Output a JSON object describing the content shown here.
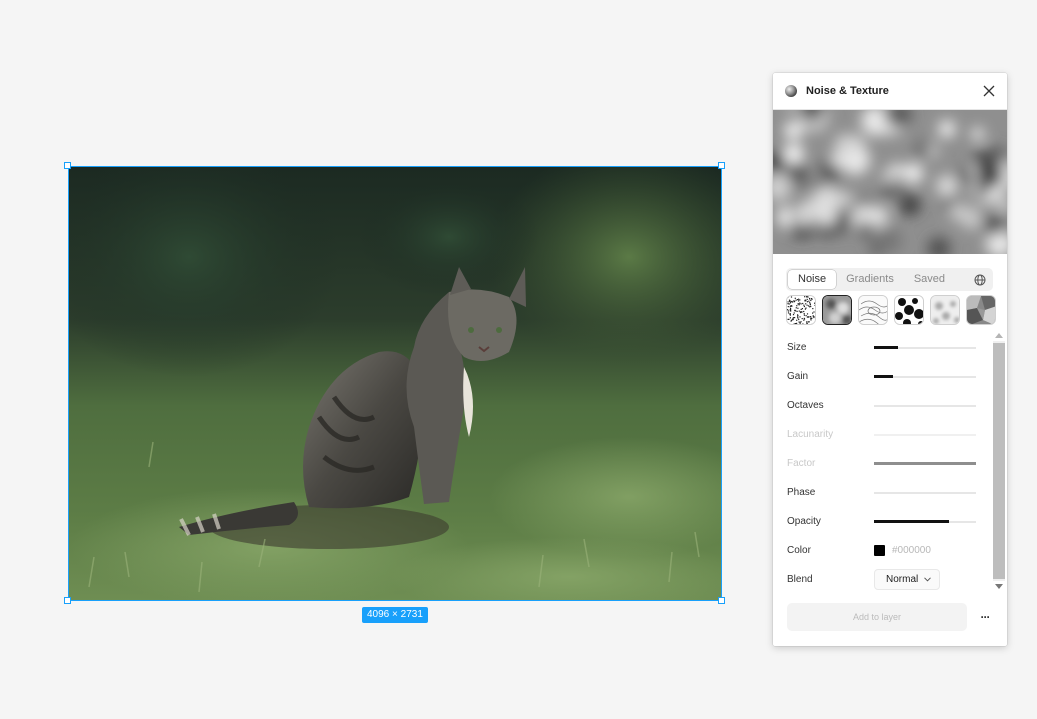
{
  "canvas": {
    "image_dimensions": "4096 × 2731",
    "selection_color": "#18a0fb"
  },
  "panel": {
    "title": "Noise & Texture",
    "icon": "plugin-globe-icon",
    "tabs": [
      {
        "label": "Noise",
        "active": true
      },
      {
        "label": "Gradients",
        "active": false
      },
      {
        "label": "Saved",
        "active": false
      }
    ],
    "globe_icon": "globe-icon",
    "presets": [
      {
        "name": "static",
        "selected": false
      },
      {
        "name": "blur",
        "selected": true
      },
      {
        "name": "contour",
        "selected": false
      },
      {
        "name": "blobs",
        "selected": false
      },
      {
        "name": "marble",
        "selected": false
      },
      {
        "name": "cells",
        "selected": false
      }
    ],
    "controls": {
      "size": {
        "label": "Size",
        "value": 0.24
      },
      "gain": {
        "label": "Gain",
        "value": 0.19
      },
      "octaves": {
        "label": "Octaves",
        "value": 0
      },
      "lacunarity": {
        "label": "Lacunarity",
        "value": 0,
        "disabled": true
      },
      "factor": {
        "label": "Factor",
        "value": 1.0,
        "disabled": true
      },
      "phase": {
        "label": "Phase",
        "value": 0
      },
      "opacity": {
        "label": "Opacity",
        "value": 0.74
      },
      "color": {
        "label": "Color",
        "hex": "#000000"
      },
      "blend": {
        "label": "Blend",
        "value": "Normal"
      }
    },
    "add_button": "Add to layer",
    "more_icon": "more-options-icon"
  }
}
